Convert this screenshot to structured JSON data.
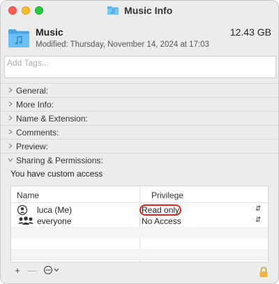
{
  "window": {
    "title": "Music Info"
  },
  "header": {
    "name": "Music",
    "size": "12.43 GB",
    "modified": "Modified: Thursday, November 14, 2024 at 17:03"
  },
  "tags": {
    "placeholder": "Add Tags..."
  },
  "sections": [
    {
      "label": "General:"
    },
    {
      "label": "More Info:"
    },
    {
      "label": "Name & Extension:"
    },
    {
      "label": "Comments:"
    },
    {
      "label": "Preview:"
    },
    {
      "label": "Sharing & Permissions:"
    }
  ],
  "sharing": {
    "custom_access": "You have custom access",
    "columns": {
      "name": "Name",
      "privilege": "Privilege"
    },
    "rows": [
      {
        "name": "luca (Me)",
        "privilege": "Read only",
        "icon": "person-icon"
      },
      {
        "name": "everyone",
        "privilege": "No Access",
        "icon": "group-icon"
      }
    ],
    "buttons": {
      "add": "+",
      "remove": "—"
    }
  },
  "colors": {
    "highlight": "#d9271e",
    "folder": "#5ab4ef"
  }
}
